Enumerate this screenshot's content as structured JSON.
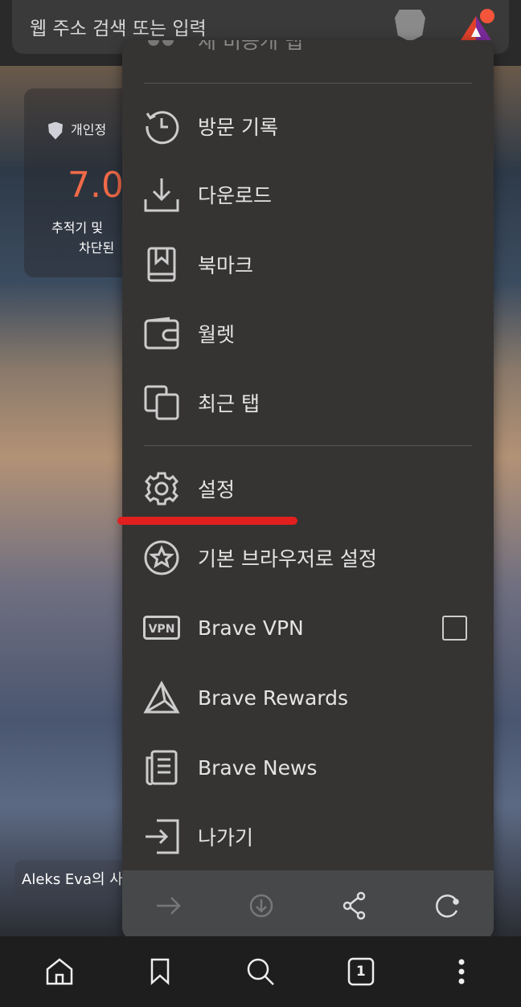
{
  "address_bar": {
    "placeholder": "웹 주소 검색 또는 입력"
  },
  "ntp": {
    "privacy_label": "개인정",
    "stat_value": "7.0",
    "stat_line1": "추적기 및",
    "stat_line2": "차단된",
    "photo_credit": "Aleks Eva의 사"
  },
  "menu": {
    "partial_item": "새 비공개 탭",
    "items": [
      {
        "label": "방문 기록",
        "icon": "history-icon"
      },
      {
        "label": "다운로드",
        "icon": "download-icon"
      },
      {
        "label": "북마크",
        "icon": "bookmark-book-icon"
      },
      {
        "label": "월렛",
        "icon": "wallet-icon"
      },
      {
        "label": "최근 탭",
        "icon": "recent-tabs-icon"
      },
      {
        "label": "설정",
        "icon": "gear-icon"
      },
      {
        "label": "기본 브라우저로 설정",
        "icon": "star-circle-icon"
      },
      {
        "label": "Brave VPN",
        "icon": "vpn-icon",
        "checked": false,
        "icon_text": "VPN"
      },
      {
        "label": "Brave Rewards",
        "icon": "rewards-triangle-icon"
      },
      {
        "label": "Brave News",
        "icon": "news-icon"
      },
      {
        "label": "나가기",
        "icon": "exit-icon"
      }
    ],
    "actions": [
      "forward-icon",
      "download-page-icon",
      "share-icon",
      "reload-icon"
    ]
  },
  "bottom_nav": {
    "tab_count": "1",
    "items": [
      "home-icon",
      "bookmark-icon",
      "search-icon",
      "tabs-icon",
      "more-icon"
    ]
  },
  "colors": {
    "menu_bg": "#363433",
    "action_bar": "#47484a",
    "highlight": "#e21f1f",
    "stat": "#f06a48"
  }
}
